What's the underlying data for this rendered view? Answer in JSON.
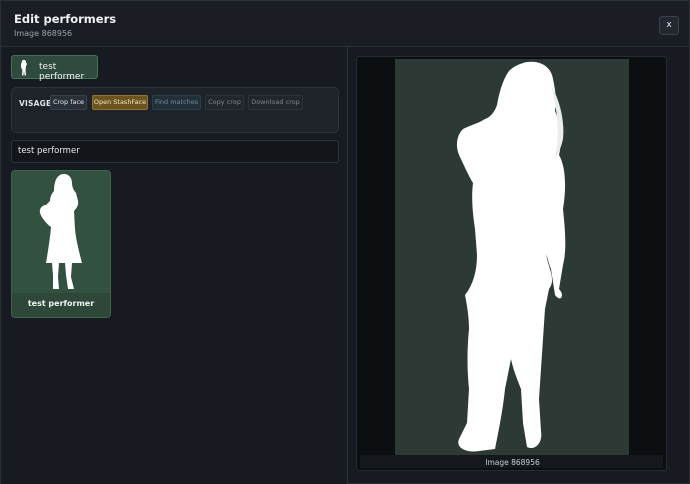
{
  "header": {
    "title": "Edit performers",
    "subtitle": "Image 868956",
    "close_label": "x"
  },
  "performer_chip": {
    "label": "test performer"
  },
  "visage": {
    "label": "VISAGE",
    "buttons": {
      "crop_face": "Crop face",
      "open_stashface": "Open StashFace",
      "find_matches": "Find matches",
      "copy_crop": "Copy crop",
      "download_crop": "Download crop"
    }
  },
  "search": {
    "value": "test performer"
  },
  "results": [
    {
      "name": "test performer"
    }
  ],
  "preview": {
    "caption": "Image 868956"
  },
  "colors": {
    "selected_green": "#2f4b3d",
    "stashface_accent": "#6b5420"
  }
}
